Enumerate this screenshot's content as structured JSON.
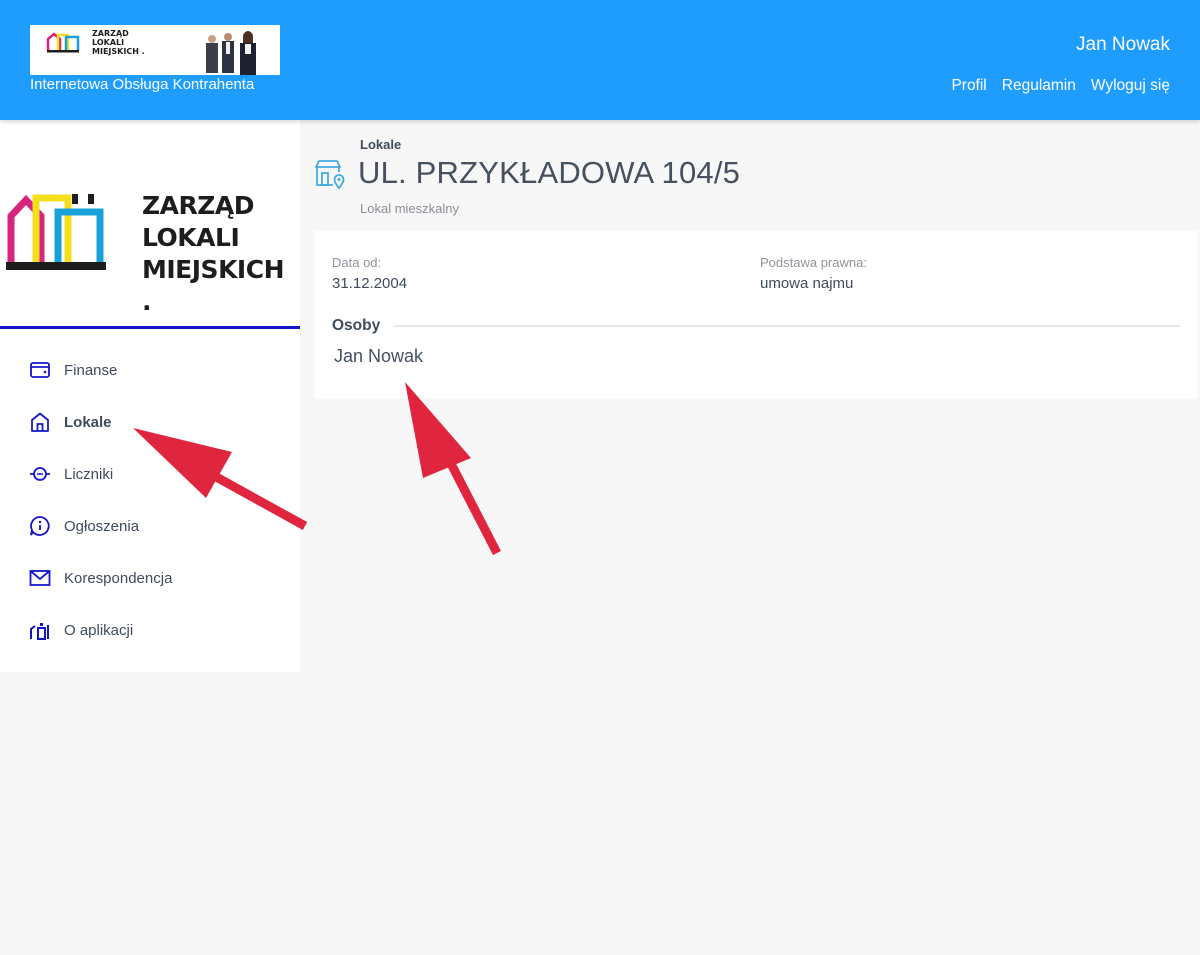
{
  "header": {
    "banner_logo_text": "ZARZĄD LOKALI MIEJSKICH .",
    "subtitle": "Internetowa Obsługa Kontrahenta",
    "user_name": "Jan Nowak",
    "links": {
      "profile": "Profil",
      "terms": "Regulamin",
      "logout": "Wyloguj się"
    },
    "color": "#1e9dff"
  },
  "sidebar": {
    "logo_lines": [
      "ZARZĄD",
      "LOKALI",
      "MIEJSKICH ."
    ],
    "accent_color": "#1414c8",
    "items": [
      {
        "label": "Finanse",
        "icon": "wallet-icon"
      },
      {
        "label": "Lokale",
        "icon": "home-icon",
        "active": true
      },
      {
        "label": "Liczniki",
        "icon": "meter-icon"
      },
      {
        "label": "Ogłoszenia",
        "icon": "info-bubble-icon"
      },
      {
        "label": "Korespondencja",
        "icon": "envelope-icon"
      },
      {
        "label": "O aplikacji",
        "icon": "app-info-icon"
      }
    ]
  },
  "main": {
    "breadcrumb": "Lokale",
    "title": "UL. PRZYKŁADOWA 104/5",
    "subtitle": "Lokal mieszkalny",
    "card": {
      "date_label": "Data od:",
      "date_value": "31.12.2004",
      "basis_label": "Podstawa prawna:",
      "basis_value": "umowa najmu",
      "persons_title": "Osoby",
      "persons": [
        "Jan Nowak"
      ]
    }
  },
  "annotation_color": "#e0253f"
}
